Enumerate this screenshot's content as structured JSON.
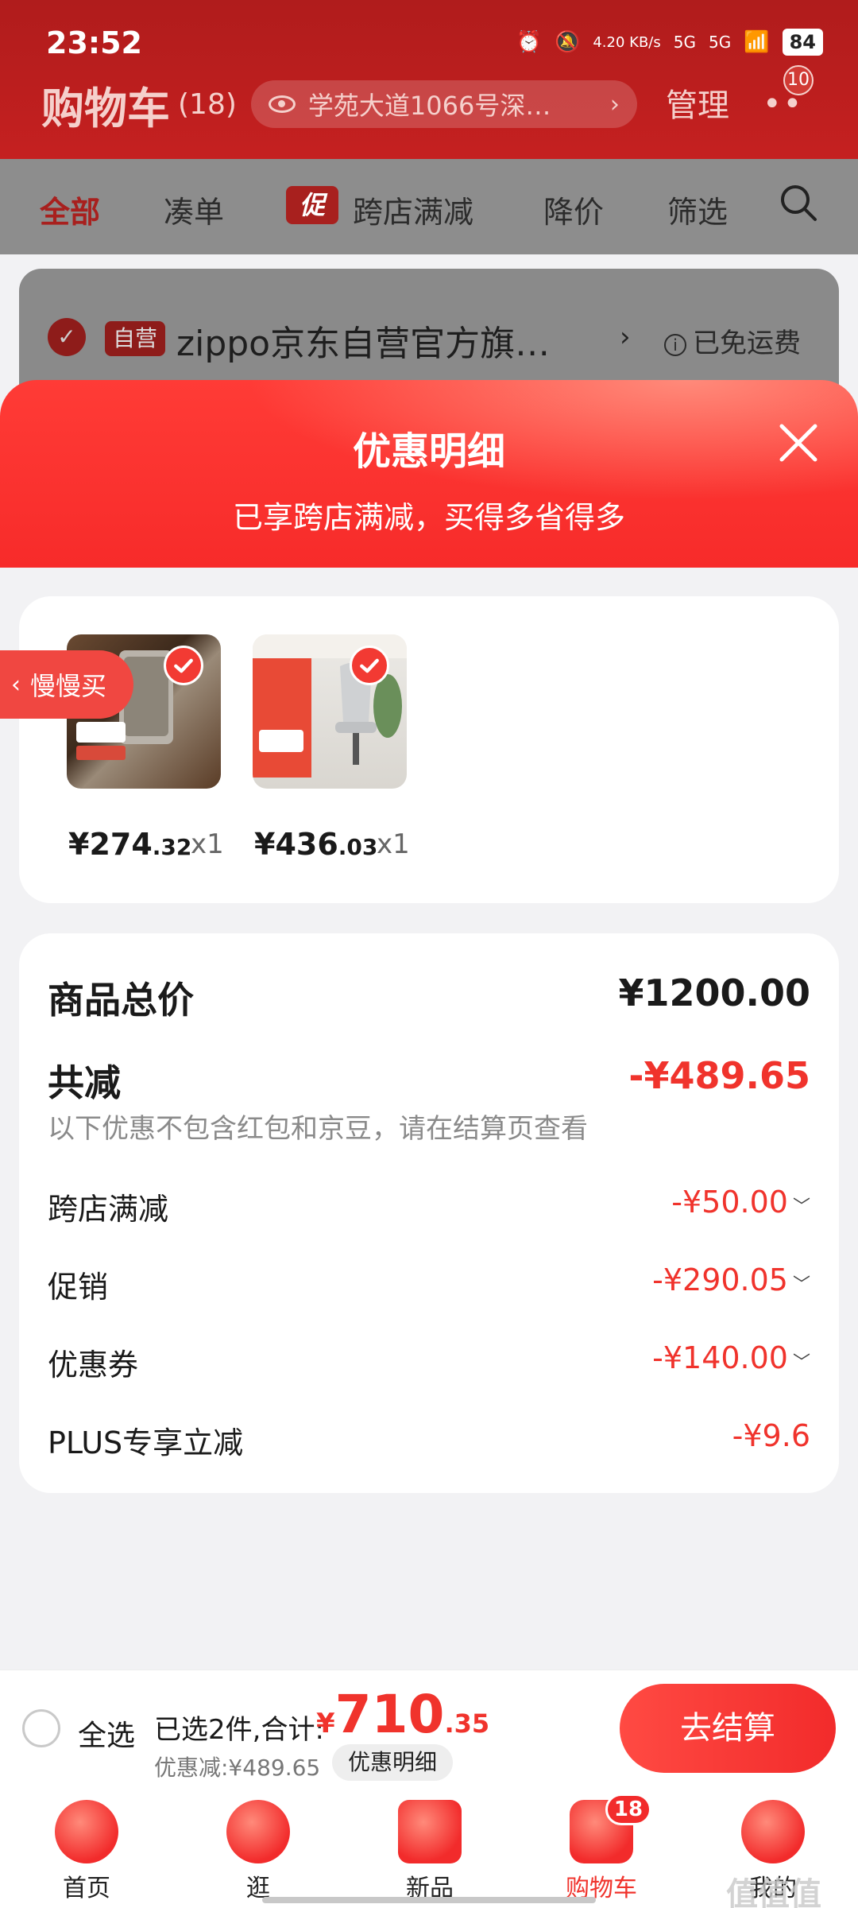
{
  "status_bar": {
    "time": "23:52",
    "net_speed": "4.20 KB/s",
    "sim1": "5G",
    "sim2": "5G",
    "battery": "84"
  },
  "header": {
    "title": "购物车",
    "count": "(18)",
    "address": "学苑大道1066号深…",
    "manage_label": "管理",
    "more_badge": "10"
  },
  "filters": [
    {
      "label": "全部"
    },
    {
      "label": "凑单"
    },
    {
      "label": "跨店满减",
      "tag": "促"
    },
    {
      "label": "降价"
    },
    {
      "label": "筛选"
    }
  ],
  "store": {
    "badge": "自营",
    "name": "zippo京东自营官方旗…",
    "shipping": "已免运费",
    "info_glyph": "i"
  },
  "modal": {
    "title": "优惠明细",
    "subtitle": "已享跨店满减，买得多省得多",
    "slow_buy_label": "慢慢买",
    "products": [
      {
        "price_int": "¥274",
        "price_dec": ".32",
        "qty": "x1"
      },
      {
        "price_int": "¥436",
        "price_dec": ".03",
        "qty": "x1"
      }
    ],
    "summary": {
      "total_label": "商品总价",
      "total_value": "¥1200.00",
      "reduce_label": "共减",
      "reduce_value": "-¥489.65",
      "note": "以下优惠不包含红包和京豆，请在结算页查看",
      "items": [
        {
          "label": "跨店满减",
          "value": "-¥50.00",
          "caret": "﹀"
        },
        {
          "label": "促销",
          "value": "-¥290.05",
          "caret": "﹀"
        },
        {
          "label": "优惠券",
          "value": "-¥140.00",
          "caret": "﹀"
        },
        {
          "label": "PLUS专享立减",
          "value": "-¥9.6",
          "caret": ""
        }
      ]
    }
  },
  "checkout": {
    "select_all": "全选",
    "selected_text": "已选2件,合计:",
    "sum_currency": "¥",
    "sum_int": "710",
    "sum_dec": ".35",
    "discount_text": "优惠减:¥489.65",
    "detail_label": "优惠明细",
    "button_label": "去结算"
  },
  "tabbar": {
    "items": [
      {
        "label": "首页"
      },
      {
        "label": "逛"
      },
      {
        "label": "新品"
      },
      {
        "label": "购物车"
      },
      {
        "label": "我的"
      }
    ],
    "cart_badge": "18"
  },
  "watermark": "值值值",
  "colors": {
    "accent": "#f22b2b",
    "price_red": "#f0332c",
    "header_red": "#c52020"
  }
}
